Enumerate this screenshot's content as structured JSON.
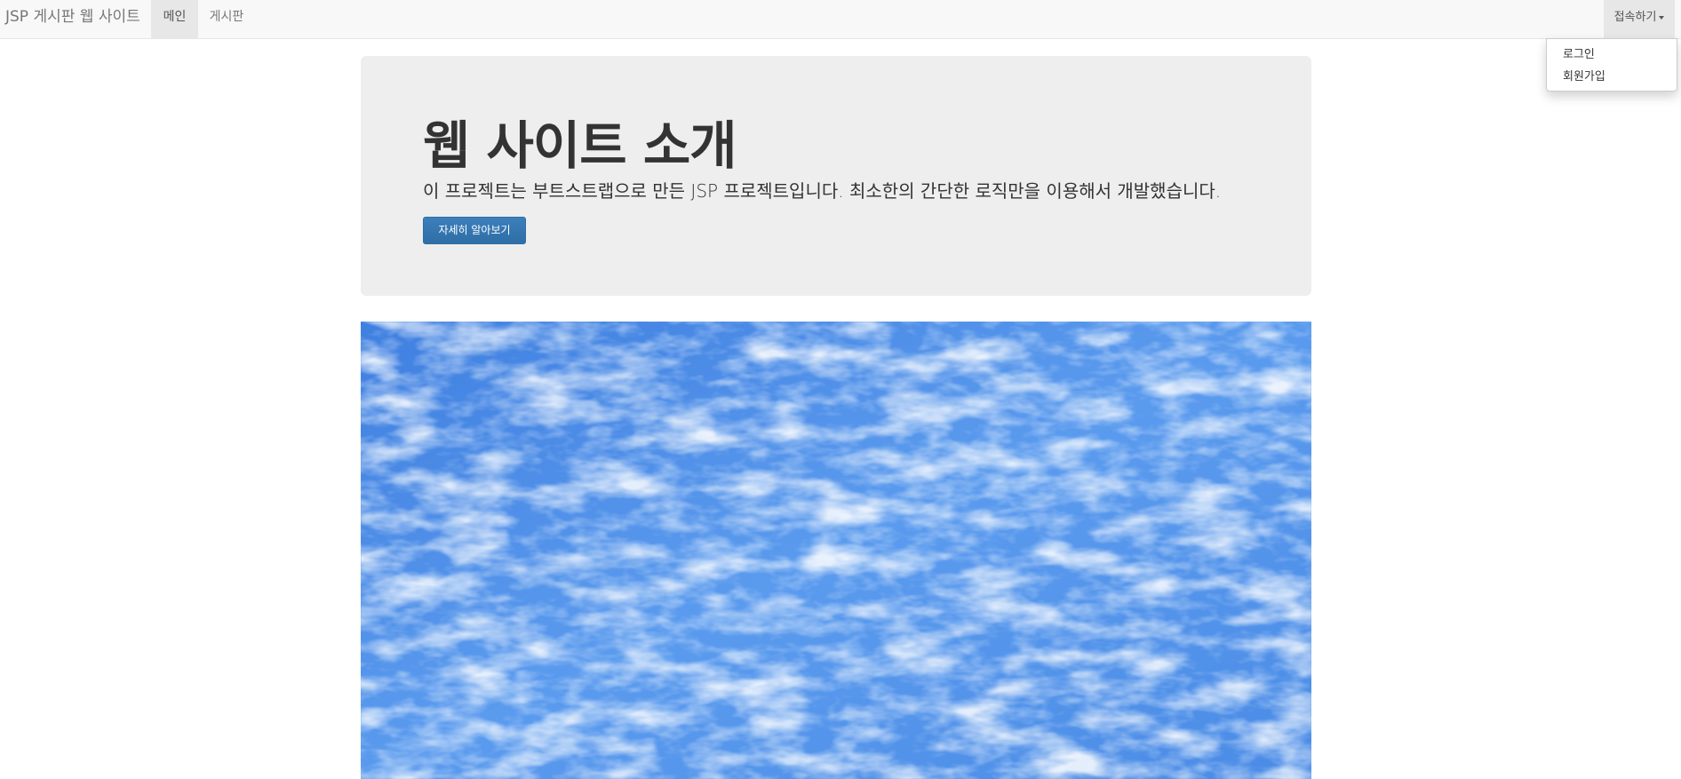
{
  "navbar": {
    "brand": "JSP 게시판 웹 사이트",
    "items": [
      {
        "label": "메인",
        "active": true
      },
      {
        "label": "게시판",
        "active": false
      }
    ],
    "account_menu": {
      "label": "접속하기",
      "options": [
        "로그인",
        "회원가입"
      ]
    }
  },
  "jumbotron": {
    "title": "웹 사이트 소개",
    "description": "이 프로젝트는 부트스트랩으로 만든 JSP 프로젝트입니다. 최소한의 간단한 로직만을 이용해서 개발했습니다.",
    "button_label": "자세히 알아보기"
  },
  "colors": {
    "navbar_bg": "#f8f8f8",
    "active_tab_bg": "#e7e7e7",
    "jumbotron_bg": "#eeeeee",
    "primary_button": "#337ab7",
    "sky_blue": "#4d8fe8"
  }
}
